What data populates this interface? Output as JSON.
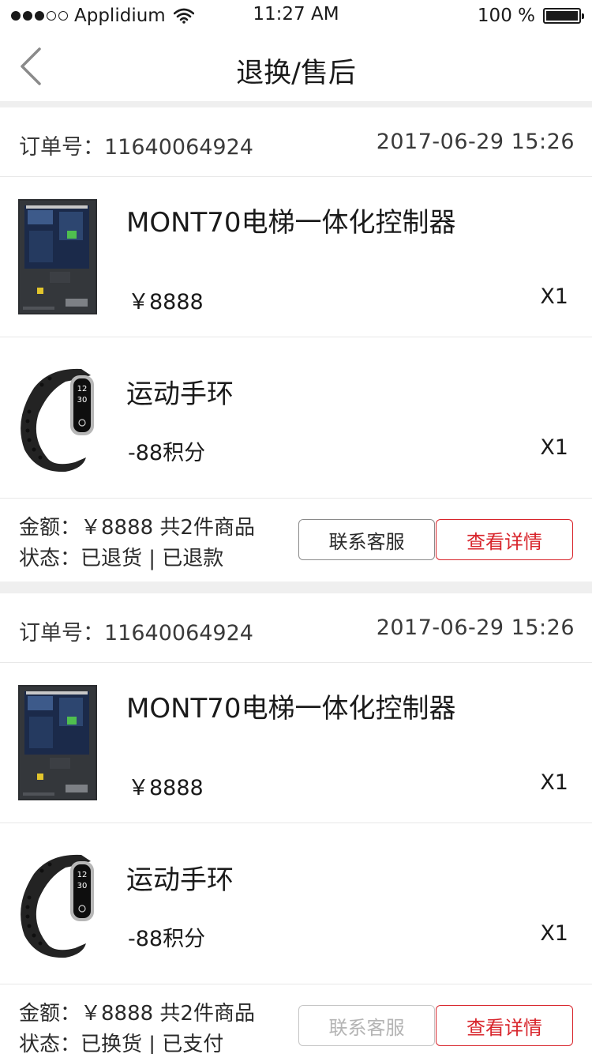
{
  "status_bar": {
    "carrier": "Applidium",
    "time": "11:27 AM",
    "battery": "100 %",
    "battery_level": 1.0
  },
  "nav": {
    "title": "退换/售后",
    "back_icon": "chevron-left-icon"
  },
  "colors": {
    "accent": "#d8242b",
    "divider": "#efefef",
    "text": "#1a1a1a"
  },
  "orders": [
    {
      "order_no": "订单号：11640064924",
      "datetime": "2017-06-29   15:26",
      "items": [
        {
          "name": "MONT70电梯一体化控制器",
          "price": "￥8888",
          "qty": "X1",
          "image": "controller-image"
        },
        {
          "name": "运动手环",
          "price": "-88积分",
          "qty": "X1",
          "image": "wristband-image"
        }
      ],
      "amount": "金额：￥8888 共2件商品",
      "status": "状态：已退货 | 已退款",
      "contact_label": "联系客服",
      "contact_enabled": true,
      "detail_label": "查看详情"
    },
    {
      "order_no": "订单号：11640064924",
      "datetime": "2017-06-29   15:26",
      "items": [
        {
          "name": "MONT70电梯一体化控制器",
          "price": "￥8888",
          "qty": "X1",
          "image": "controller-image"
        },
        {
          "name": "运动手环",
          "price": "-88积分",
          "qty": "X1",
          "image": "wristband-image"
        }
      ],
      "amount": "金额：￥8888 共2件商品",
      "status": "状态：已换货 | 已支付",
      "contact_label": "联系客服",
      "contact_enabled": false,
      "detail_label": "查看详情"
    }
  ]
}
